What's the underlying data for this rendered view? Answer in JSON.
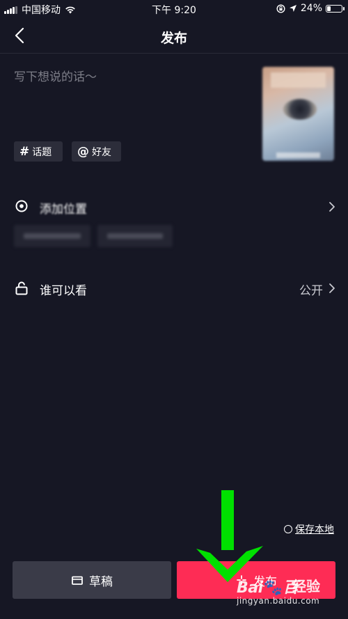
{
  "status_bar": {
    "carrier": "中国移动",
    "time": "下午 9:20",
    "battery_pct": "24%",
    "battery_level": 0.24
  },
  "nav": {
    "title": "发布"
  },
  "caption": {
    "placeholder": "写下想说的话～",
    "value": ""
  },
  "tags": {
    "topic": {
      "symbol": "#",
      "label": "话题"
    },
    "friend": {
      "symbol": "@",
      "label": "好友"
    }
  },
  "location": {
    "label": "添加位置",
    "suggestions": [
      "",
      ""
    ]
  },
  "privacy": {
    "label": "谁可以看",
    "value": "公开"
  },
  "save_local": {
    "label": "保存本地",
    "checked": false
  },
  "footer": {
    "draft_label": "草稿",
    "publish_label": "发布"
  },
  "colors": {
    "background": "#161724",
    "publish": "#fe2c55",
    "draft": "#3a3b48",
    "chip": "#2c2d3a",
    "arrow": "#00e000"
  },
  "watermark": {
    "logo_pre": "Bai",
    "logo_post": "百",
    "paw": "🐾",
    "jy": "经验",
    "url": "jingyan.baidu.com"
  }
}
